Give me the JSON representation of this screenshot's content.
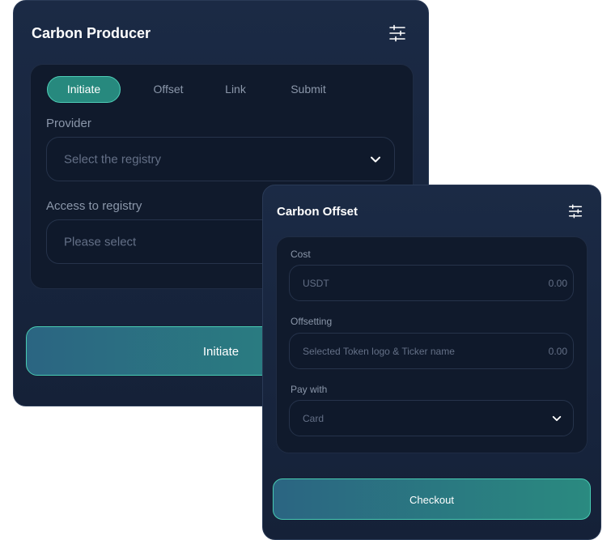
{
  "producer": {
    "title": "Carbon Producer",
    "tabs": [
      "Initiate",
      "Offset",
      "Link",
      "Submit"
    ],
    "active_tab": "Initiate",
    "provider_label": "Provider",
    "provider_placeholder": "Select the registry",
    "access_label": "Access to registry",
    "access_placeholder": "Please select",
    "button_label": "Initiate"
  },
  "offset": {
    "title": "Carbon Offset",
    "cost_label": "Cost",
    "cost_placeholder": "USDT",
    "cost_value": "0.00",
    "offsetting_label": "Offsetting",
    "offsetting_placeholder": "Selected Token logo & Ticker name",
    "offsetting_value": "0.00",
    "pay_label": "Pay with",
    "pay_value": "Card",
    "button_label": "Checkout"
  },
  "icons": {
    "settings": "sliders-icon",
    "dropdown": "chevron-down-icon"
  },
  "colors": {
    "card_bg": "#1b2a45",
    "inner_bg": "#101a2c",
    "accent": "#2a8a80",
    "accent_border": "#48cbb2",
    "muted_text": "#8b97aa"
  }
}
